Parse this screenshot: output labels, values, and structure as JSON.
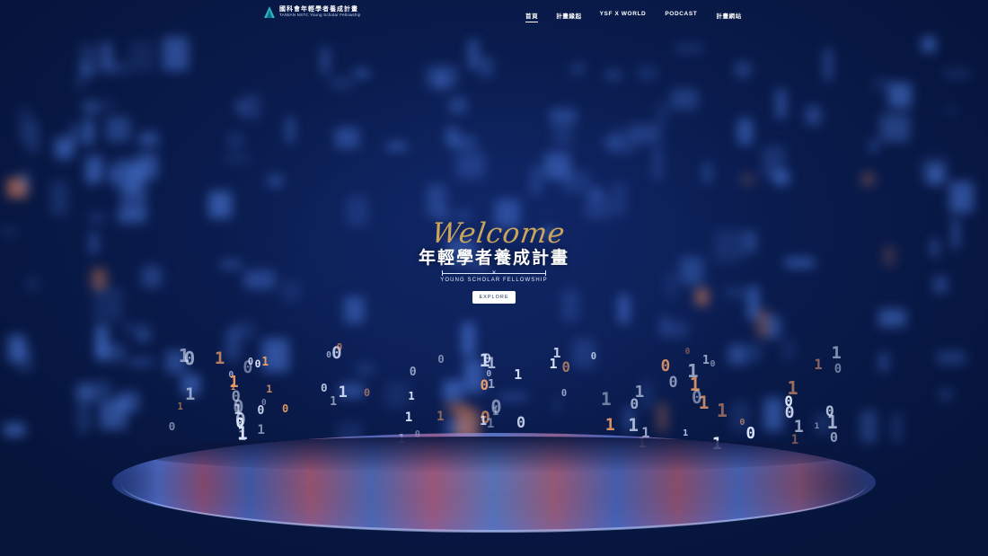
{
  "brand": {
    "title": "國科會年輕學者養成計畫",
    "subtitle": "TAIWAN NSTC Young Scholar Fellowship",
    "icon": "mountain-logo-icon"
  },
  "nav": {
    "items": [
      {
        "label": "首頁",
        "active": true
      },
      {
        "label": "計畫緣起",
        "active": false
      },
      {
        "label": "YSF X WORLD",
        "active": false
      },
      {
        "label": "PODCAST",
        "active": false
      },
      {
        "label": "計畫網站",
        "active": false
      }
    ]
  },
  "hero": {
    "welcome": "Welcome",
    "title": "年輕學者養成計畫",
    "subtitle": "YOUNG SCHOLAR FELLOWSHIP",
    "button": "EXPLORE"
  },
  "colors": {
    "background": "#06143a",
    "accent_gold": "#c9a45c",
    "bokeh_blue": "#4f7de0",
    "bokeh_orange": "#e9875a"
  }
}
